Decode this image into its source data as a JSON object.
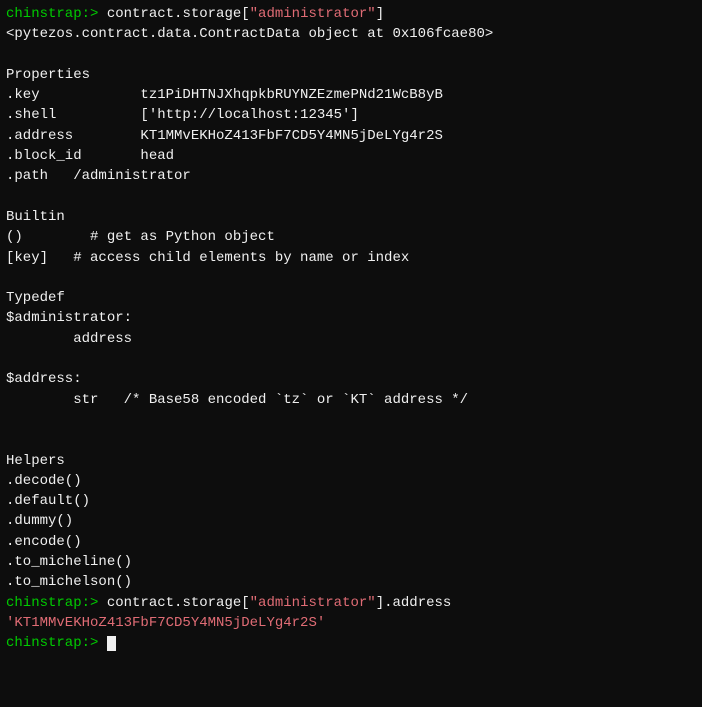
{
  "terminal": {
    "lines": [
      {
        "type": "prompt-cmd",
        "prompt": "chinstrap:> ",
        "command": "contract.storage[",
        "string": "\"administrator\"",
        "command2": "]"
      },
      {
        "type": "plain",
        "text": "<pytezos.contract.data.ContractData object at 0x106fcae80>"
      },
      {
        "type": "blank"
      },
      {
        "type": "plain",
        "text": "Properties"
      },
      {
        "type": "property",
        "name": ".key",
        "pad": "            ",
        "value": "tz1PiDHTNJXhqpkbRUYNZEzmePNd21WcB8yB"
      },
      {
        "type": "property",
        "name": ".shell",
        "pad": "          ",
        "value": "['http://localhost:12345']"
      },
      {
        "type": "property",
        "name": ".address",
        "pad": "        ",
        "value": "KT1MMvEKHoZ413FbF7CD5Y4MN5jDeLYg4r2S"
      },
      {
        "type": "property",
        "name": ".block_id",
        "pad": "       ",
        "value": "head"
      },
      {
        "type": "property",
        "name": ".path",
        "pad": "   ",
        "value": "/administrator"
      },
      {
        "type": "blank"
      },
      {
        "type": "plain",
        "text": "Builtin"
      },
      {
        "type": "plain",
        "text": "()        # get as Python object"
      },
      {
        "type": "plain",
        "text": "[key]   # access child elements by name or index"
      },
      {
        "type": "blank"
      },
      {
        "type": "plain",
        "text": "Typedef"
      },
      {
        "type": "plain",
        "text": "$administrator:"
      },
      {
        "type": "plain",
        "text": "        address"
      },
      {
        "type": "blank"
      },
      {
        "type": "plain",
        "text": "$address:"
      },
      {
        "type": "plain",
        "text": "        str   /* Base58 encoded `tz` or `KT` address */"
      },
      {
        "type": "blank"
      },
      {
        "type": "blank"
      },
      {
        "type": "plain",
        "text": "Helpers"
      },
      {
        "type": "plain",
        "text": ".decode()"
      },
      {
        "type": "plain",
        "text": ".default()"
      },
      {
        "type": "plain",
        "text": ".dummy()"
      },
      {
        "type": "plain",
        "text": ".encode()"
      },
      {
        "type": "plain",
        "text": ".to_micheline()"
      },
      {
        "type": "plain",
        "text": ".to_michelson()"
      },
      {
        "type": "prompt-cmd2",
        "prompt": "chinstrap:> ",
        "command": "contract.storage[",
        "string": "\"administrator\"",
        "command2": "].address"
      },
      {
        "type": "red",
        "text": "'KT1MMvEKHoZ413FbF7CD5Y4MN5jDeLYg4r2S'"
      },
      {
        "type": "prompt-cursor",
        "prompt": "chinstrap:> "
      }
    ]
  }
}
